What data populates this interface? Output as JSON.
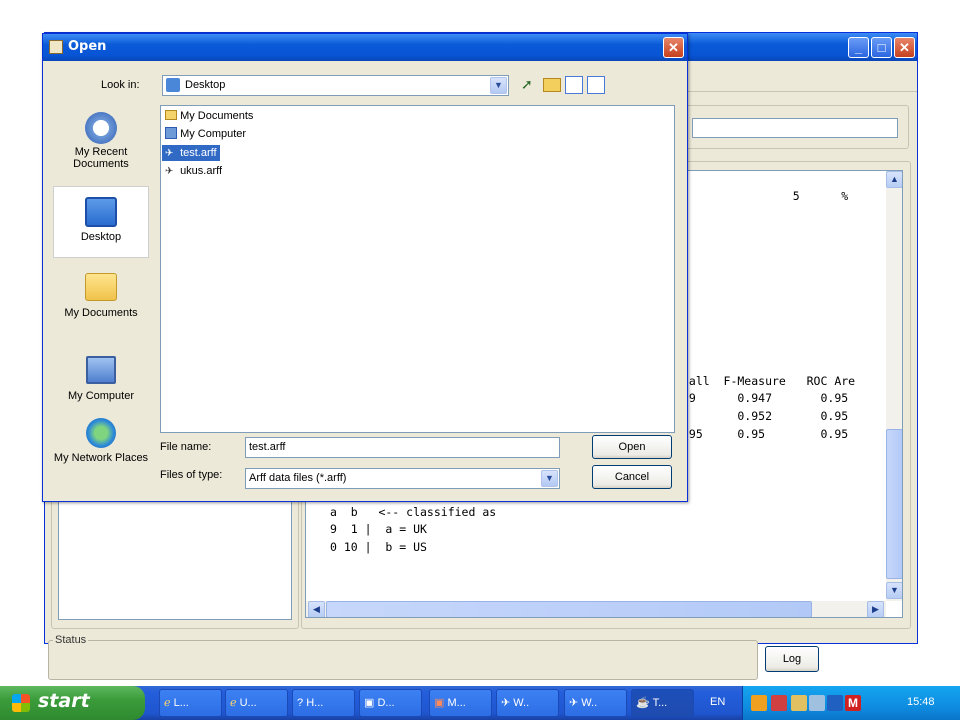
{
  "dialog": {
    "title": "Open",
    "look_in_label": "Look in:",
    "look_in_value": "Desktop",
    "places": [
      {
        "label": "My Recent Documents",
        "icon": "recent-documents-icon"
      },
      {
        "label": "Desktop",
        "icon": "desktop-icon"
      },
      {
        "label": "My Documents",
        "icon": "my-documents-icon"
      },
      {
        "label": "My Computer",
        "icon": "my-computer-icon"
      },
      {
        "label": "My Network Places",
        "icon": "network-places-icon"
      }
    ],
    "files": [
      {
        "name": "My Documents",
        "icon": "folder-icon"
      },
      {
        "name": "My Computer",
        "icon": "computer-icon"
      },
      {
        "name": "test.arff",
        "icon": "weka-file-icon",
        "selected": true
      },
      {
        "name": "ukus.arff",
        "icon": "weka-file-icon"
      }
    ],
    "file_name_label": "File name:",
    "file_name_value": "test.arff",
    "files_of_type_label": "Files of type:",
    "files_of_type_value": "Arff data files (*.arff)",
    "open_button": "Open",
    "cancel_button": "Cancel"
  },
  "output": {
    "lines_right": [
      "                5      %",
      "call  F-Measure   ROC Are",
      ".9      0.947       0.95",
      "        0.952       0.95",
      ".95     0.95        0.95"
    ],
    "confusion": [
      "a  b   <-- classified as",
      "9  1 |  a = UK",
      "0 10 |  b = US"
    ]
  },
  "main_window": {
    "status_label": "Status",
    "log_button": "Log"
  },
  "taskbar": {
    "start_label": "start",
    "tasks": [
      "L...",
      "U...",
      "H...",
      "D...",
      "M...",
      "W..",
      "W..",
      "T..."
    ],
    "language": "EN",
    "clock": "15:48"
  },
  "colors": {
    "xp_blue": "#0a5ad8",
    "dialog_face": "#ece9d8",
    "selection": "#316ac5"
  }
}
